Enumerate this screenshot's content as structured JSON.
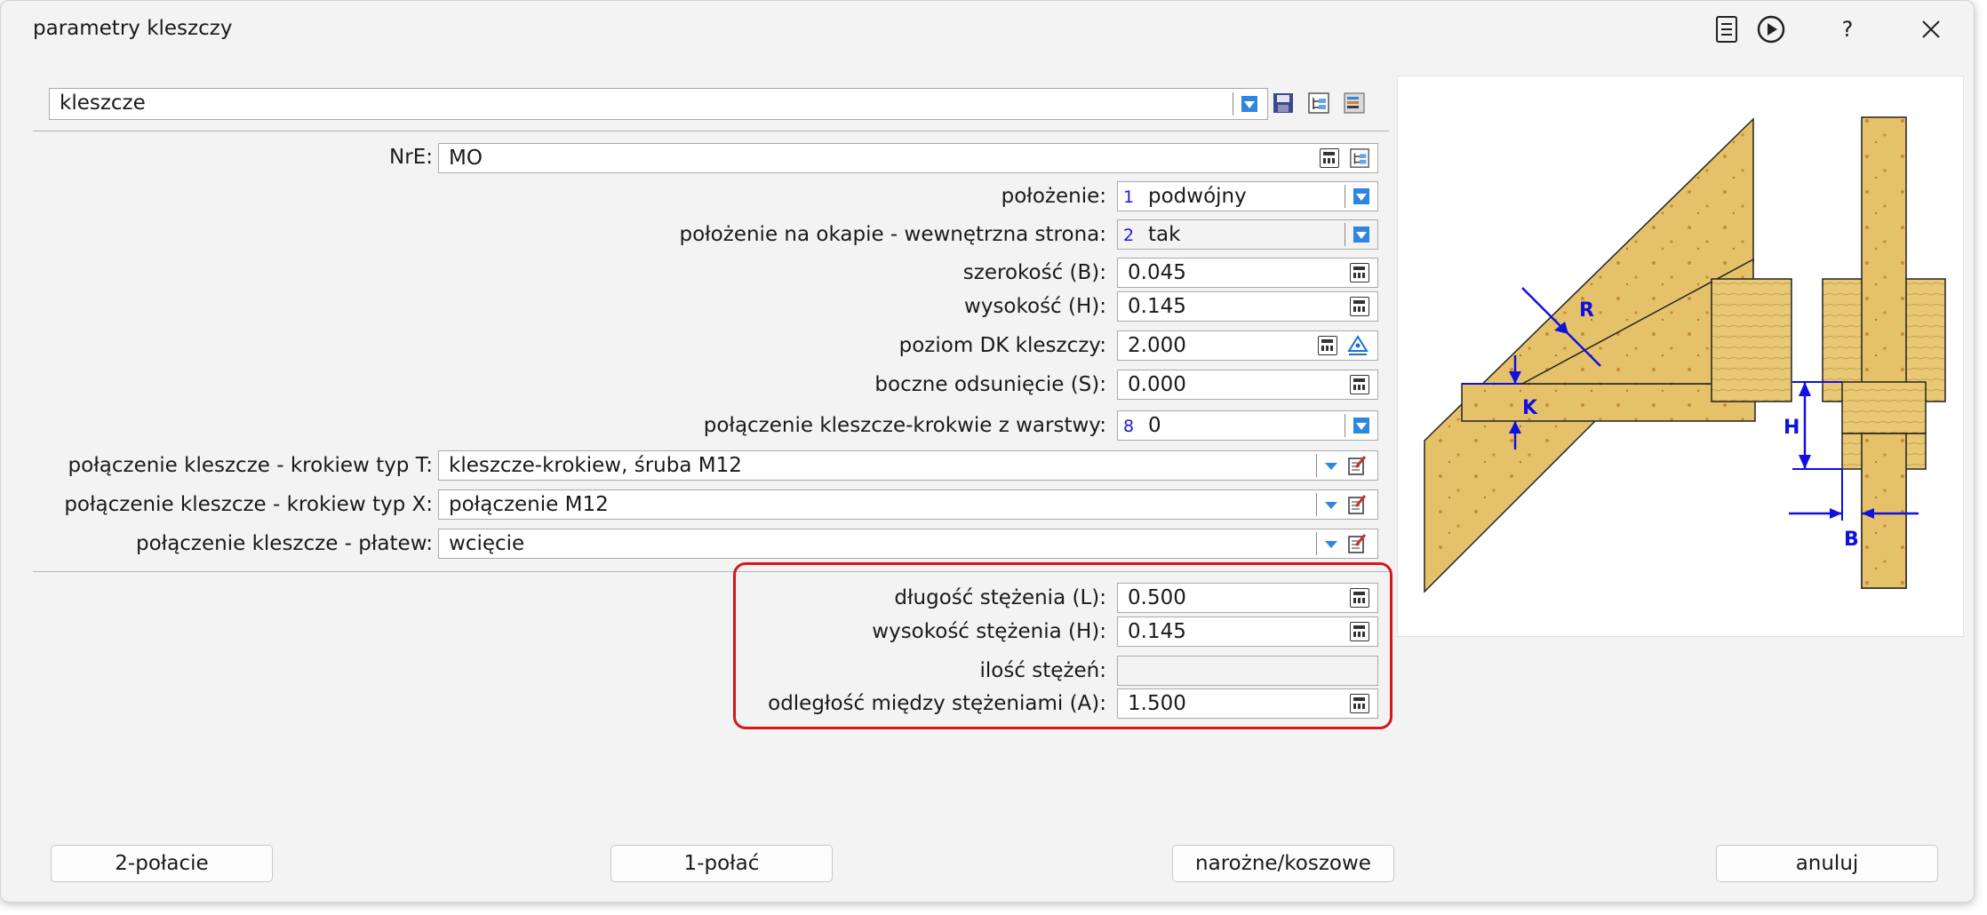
{
  "window": {
    "title": "parametry kleszczy"
  },
  "titlebar_icons": [
    "document-list-icon",
    "play-circle-icon",
    "help-icon",
    "close-icon"
  ],
  "titlebar_help": "?",
  "type_select": {
    "value": "kleszcze"
  },
  "nre": {
    "label": "NrE:",
    "value": "MO"
  },
  "fields": {
    "polozenie": {
      "label": "położenie:",
      "code": "1",
      "value": "podwójny"
    },
    "polozenie_okap": {
      "label": "położenie na okapie - wewnętrzna strona:",
      "code": "2",
      "value": "tak"
    },
    "szerokosc": {
      "label": "szerokość (B):",
      "value": "0.045"
    },
    "wysokosc": {
      "label": "wysokość (H):",
      "value": "0.145"
    },
    "poziom_dk": {
      "label": "poziom DK kleszczy:",
      "value": "2.000"
    },
    "boczne": {
      "label": "boczne odsunięcie (S):",
      "value": "0.000"
    },
    "polaczenie_warstwy": {
      "label": "połączenie kleszcze-krokwie z warstwy:",
      "code": "8",
      "value": "0"
    },
    "typ_t": {
      "label": "połączenie kleszcze - krokiew typ T:",
      "value": "kleszcze-krokiew, śruba M12"
    },
    "typ_x": {
      "label": "połączenie kleszcze - krokiew typ X:",
      "value": "połączenie M12"
    },
    "platew": {
      "label": "połączenie kleszcze - płatew:",
      "value": "wcięcie"
    }
  },
  "bracing": {
    "dlugosc": {
      "label": "długość stężenia (L):",
      "value": "0.500"
    },
    "wysokosc": {
      "label": "wysokość stężenia (H):",
      "value": "0.145"
    },
    "ilosc": {
      "label": "ilość stężeń:",
      "value": ""
    },
    "odleglosc": {
      "label": "odległość między stężeniami (A):",
      "value": "1.500"
    }
  },
  "diagram_labels": {
    "r": "R",
    "k": "K",
    "h": "H",
    "b": "B"
  },
  "buttons": {
    "two_slopes": "2-połacie",
    "one_slope": "1-połać",
    "corner": "narożne/koszowe",
    "cancel": "anuluj"
  },
  "colors": {
    "accent_blue": "#1b6fd6",
    "highlight_red": "#d4161f",
    "wood": "#e5c26a",
    "dimension_blue": "#1010e0"
  }
}
